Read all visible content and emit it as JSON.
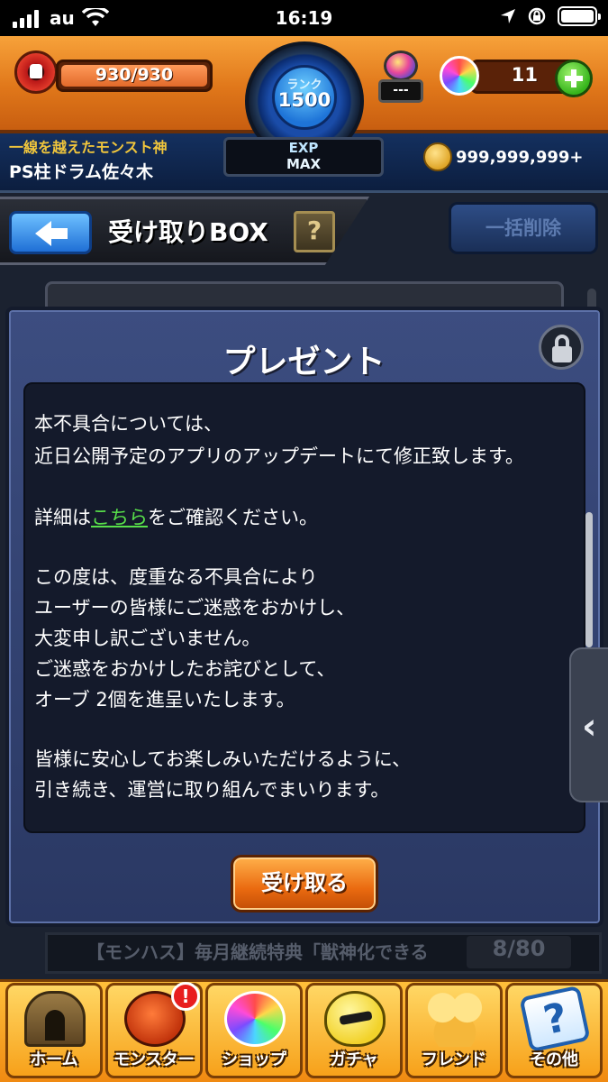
{
  "status_bar": {
    "carrier": "au",
    "time": "16:19"
  },
  "header": {
    "stamina": "930/930",
    "stamina_fraction": 1.0,
    "rank_label": "ランク",
    "rank_value": "1500",
    "exp_label": "EXP",
    "exp_value": "MAX",
    "luck_value": "---",
    "orb_count": "11",
    "player_title": "一線を越えたモンスト神",
    "player_name": "PS柱ドラム佐々木",
    "coins": "999,999,999+"
  },
  "subheader": {
    "title": "受け取りBOX",
    "help_label": "?",
    "bulk_delete_label": "一括削除"
  },
  "modal": {
    "title": "プレゼント",
    "lines": [
      "本不具合については、",
      "近日公開予定のアプリのアップデートにて修正致します。",
      "",
      "詳細は",
      "",
      "この度は、度重なる不具合により",
      "ユーザーの皆様にご迷惑をおかけし、",
      "大変申し訳ございません。",
      "ご迷惑をおかけしたお詫びとして、",
      "オーブ 2個を進呈いたします。",
      "",
      "皆様に安心してお楽しみいただけるように、",
      "引き続き、運営に取り組んでまいります。"
    ],
    "detail_prefix": "詳細は",
    "detail_link": "こちら",
    "detail_suffix": "をご確認ください。",
    "receive_label": "受け取る"
  },
  "background_list": {
    "row_text": "【モンハス】毎月継続特典「獣神化できる",
    "count": "8/80"
  },
  "side_tab": {
    "chevron": "‹"
  },
  "bottom_nav": [
    {
      "label": "ホーム",
      "icon": "home-gate-icon"
    },
    {
      "label": "モンスター",
      "icon": "monster-icon",
      "badge": "!"
    },
    {
      "label": "ショップ",
      "icon": "orb-icon"
    },
    {
      "label": "ガチャ",
      "icon": "egg-icon"
    },
    {
      "label": "フレンド",
      "icon": "friends-icon"
    },
    {
      "label": "その他",
      "icon": "question-icon"
    }
  ],
  "colors": {
    "header_orange": "#e0771a",
    "modal_blue": "#2a3863",
    "link_green": "#58e04a",
    "button_orange": "#ea6a10"
  }
}
